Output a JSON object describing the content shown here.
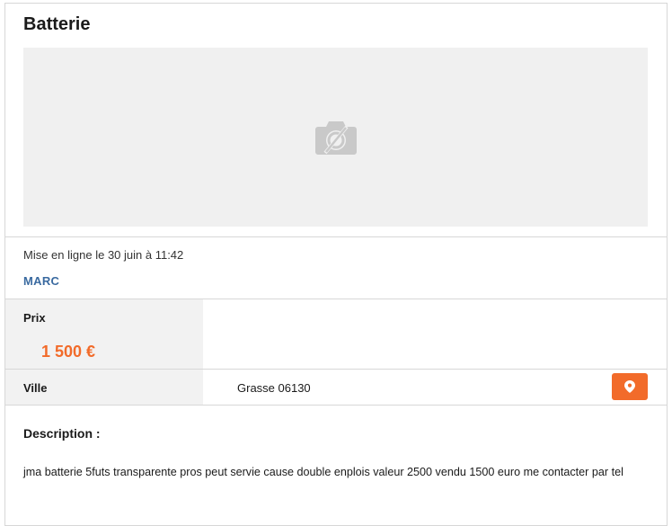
{
  "ad": {
    "title": "Batterie",
    "posted": "Mise en ligne le 30 juin à 11:42",
    "seller": "MARC",
    "price_label": "Prix",
    "price": "1 500 €",
    "city_label": "Ville",
    "city": "Grasse 06130",
    "description_title": "Description :",
    "description": "jma batterie 5futs transparente pros peut servie cause double enplois valeur 2500 vendu 1500 euro me contacter par tel"
  },
  "icons": {
    "photo_placeholder": "camera-off-icon",
    "map_button": "map-pin-icon"
  },
  "colors": {
    "accent": "#f26b2a",
    "seller_link": "#3a6aa0",
    "label_bg": "#f2f2f2",
    "photo_bg": "#f0f0f0"
  }
}
